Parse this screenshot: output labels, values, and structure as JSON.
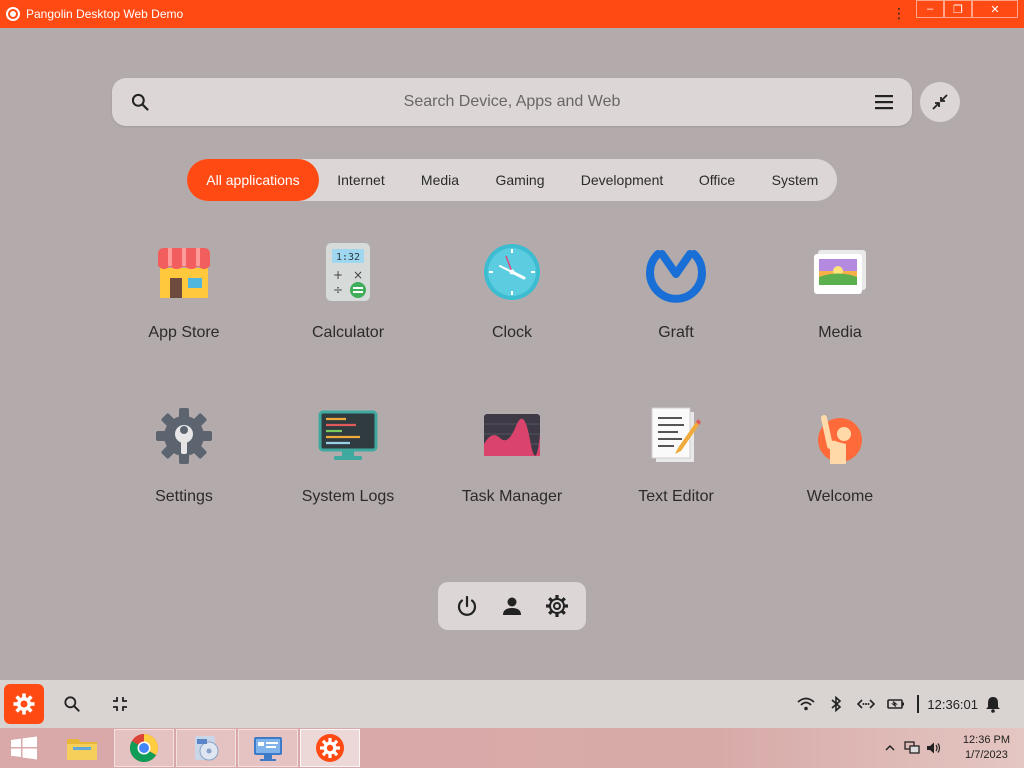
{
  "window": {
    "title": "Pangolin Desktop Web Demo",
    "accent": "#ff4a13",
    "controls": {
      "minimize": "–",
      "restore": "❐",
      "close": "✕"
    },
    "kebab": "⋮"
  },
  "search": {
    "placeholder": "Search Device, Apps and Web",
    "value": ""
  },
  "tabs": [
    {
      "label": "All applications",
      "active": true
    },
    {
      "label": "Internet",
      "active": false
    },
    {
      "label": "Media",
      "active": false
    },
    {
      "label": "Gaming",
      "active": false
    },
    {
      "label": "Development",
      "active": false
    },
    {
      "label": "Office",
      "active": false
    },
    {
      "label": "System",
      "active": false
    }
  ],
  "apps": [
    {
      "label": "App Store",
      "icon": "app-store-icon"
    },
    {
      "label": "Calculator",
      "icon": "calculator-icon"
    },
    {
      "label": "Clock",
      "icon": "clock-icon"
    },
    {
      "label": "Graft",
      "icon": "graft-icon"
    },
    {
      "label": "Media",
      "icon": "media-icon"
    },
    {
      "label": "Settings",
      "icon": "settings-icon"
    },
    {
      "label": "System Logs",
      "icon": "system-logs-icon"
    },
    {
      "label": "Task Manager",
      "icon": "task-manager-icon"
    },
    {
      "label": "Text Editor",
      "icon": "text-editor-icon"
    },
    {
      "label": "Welcome",
      "icon": "welcome-icon"
    }
  ],
  "powerbar": [
    "power-icon",
    "user-icon",
    "gear-icon"
  ],
  "taskbar": {
    "time": "12:36:01",
    "tray_icons": [
      "wifi-icon",
      "bluetooth-icon",
      "network-code-icon",
      "battery-icon"
    ]
  },
  "windows_taskbar": {
    "time": "12:36 PM",
    "date": "1/7/2023",
    "apps": [
      "file-explorer-icon",
      "chrome-icon",
      "media-player-icon",
      "control-panel-icon",
      "pangolin-icon"
    ]
  }
}
